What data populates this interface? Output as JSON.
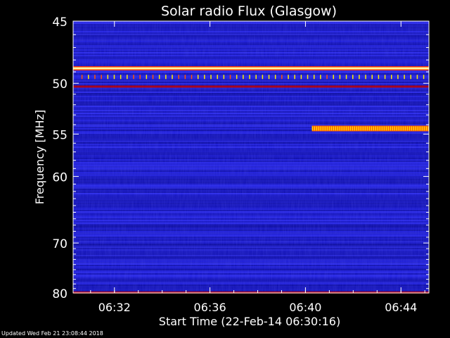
{
  "chart_data": {
    "type": "heatmap",
    "title": "Solar radio Flux (Glasgow)",
    "xlabel": "Start Time (22-Feb-14 06:30:16)",
    "ylabel": "Frequency [MHz]",
    "x_tick_labels": [
      "06:32",
      "06:36",
      "06:40",
      "06:44"
    ],
    "x_ticks_min": [
      1.73,
      5.73,
      9.73,
      13.73
    ],
    "xlim_min": [
      0,
      14.9
    ],
    "y_tick_labels": [
      "45",
      "50",
      "55",
      "60",
      "70",
      "80"
    ],
    "y_ticks_mhz": [
      45,
      50,
      55,
      60,
      70,
      80
    ],
    "ylim_mhz": [
      45,
      80
    ],
    "y_scale": "reciprocal",
    "minor_y_ticks_mhz": [
      46,
      47,
      48,
      49,
      51,
      52,
      53,
      54,
      56,
      57,
      58,
      59,
      61,
      62,
      63,
      64,
      65,
      66,
      67,
      68,
      69,
      71,
      72,
      73,
      74,
      75,
      76,
      77,
      78,
      79
    ],
    "features": [
      {
        "name": "Persistent interference line",
        "freq_mhz": 48.7,
        "intensity": "max"
      },
      {
        "name": "Periodic spikes",
        "freq_mhz": 49.5,
        "intensity": "high"
      },
      {
        "name": "Interference line",
        "freq_mhz": 50.3,
        "intensity": "medium"
      },
      {
        "name": "Drifting emission band",
        "freq_mhz": 54.4,
        "start_min": 10.0,
        "end_min": 14.9,
        "intensity": "high"
      },
      {
        "name": "Interference line",
        "freq_mhz": 79.9,
        "intensity": "medium"
      }
    ],
    "colors": {
      "background": "#1a1ad0",
      "low": "#00008a",
      "mid": "#c00000",
      "high": "#ffff00"
    },
    "grid": false
  },
  "footer_text": "Updated Wed Feb 21 23:08:44 2018"
}
